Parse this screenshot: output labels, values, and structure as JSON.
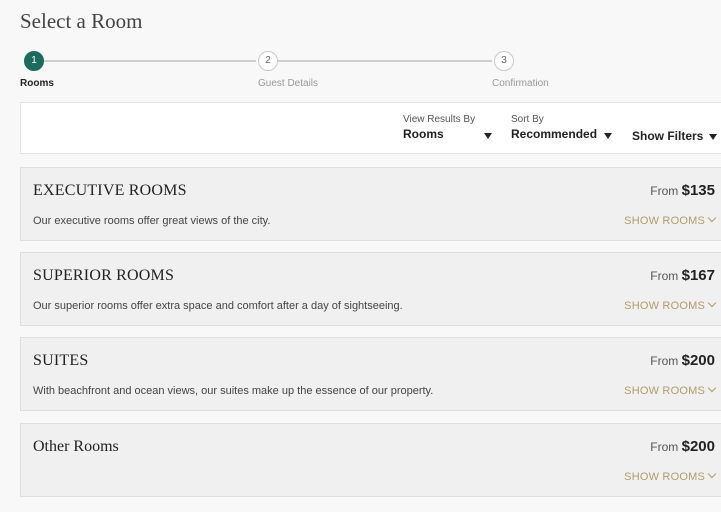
{
  "page": {
    "title": "Select a Room"
  },
  "steps": [
    {
      "number": "1",
      "label": "Rooms",
      "active": true
    },
    {
      "number": "2",
      "label": "Guest Details",
      "active": false
    },
    {
      "number": "3",
      "label": "Confirmation",
      "active": false
    }
  ],
  "filters": {
    "view_results_label": "View Results By",
    "view_results_value": "Rooms",
    "sort_label": "Sort By",
    "sort_value": "Recommended",
    "show_filters": "Show Filters"
  },
  "rooms": [
    {
      "name": "EXECUTIVE ROOMS",
      "from_label": "From",
      "price": "$135",
      "description": "Our executive rooms offer great views of the city.",
      "action": "SHOW ROOMS"
    },
    {
      "name": "SUPERIOR ROOMS",
      "from_label": "From",
      "price": "$167",
      "description": "Our superior rooms offer extra space and comfort after a day of sightseeing.",
      "action": "SHOW ROOMS"
    },
    {
      "name": "SUITES",
      "from_label": "From",
      "price": "$200",
      "description": "With beachfront and ocean views, our suites make up the essence of our property.",
      "action": "SHOW ROOMS"
    },
    {
      "name": "Other Rooms",
      "from_label": "From",
      "price": "$200",
      "description": "",
      "action": "SHOW ROOMS"
    }
  ],
  "colors": {
    "accent": "#1e6b5d",
    "link": "#b39a6a"
  }
}
